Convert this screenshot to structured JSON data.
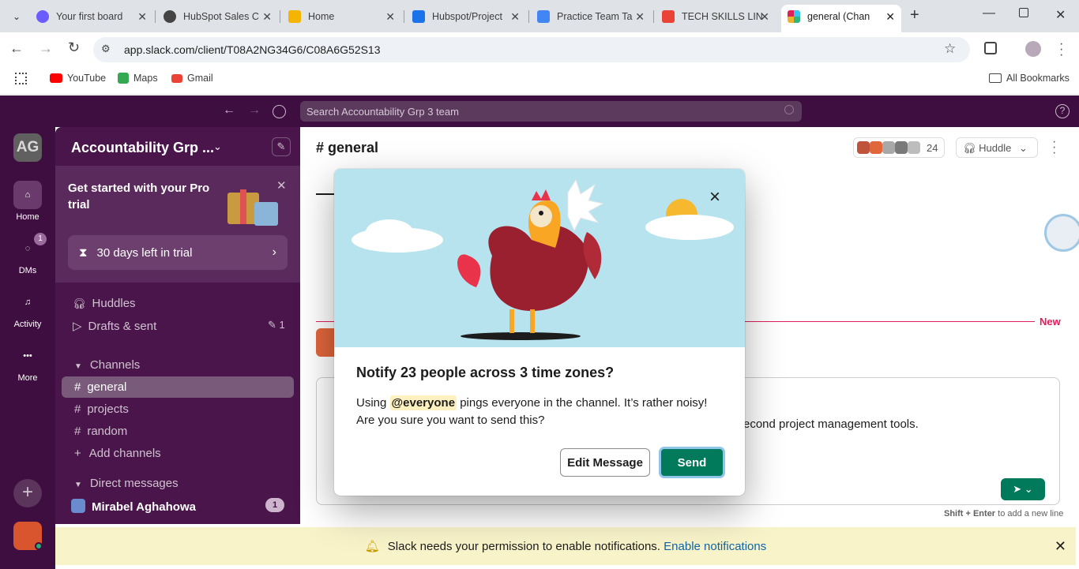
{
  "browser": {
    "tabs": [
      {
        "title": "Your first board",
        "color": "#6a5cff"
      },
      {
        "title": "HubSpot Sales C",
        "color": "#444444"
      },
      {
        "title": "Home",
        "color": "#f4b400"
      },
      {
        "title": "Hubspot/Project",
        "color": "#1a73e8"
      },
      {
        "title": "Practice Team Ta",
        "color": "#4285f4"
      },
      {
        "title": "TECH SKILLS LIN",
        "color": "#ea4335"
      },
      {
        "title": "general (Channe",
        "color": "#e01e5a"
      }
    ],
    "url": "app.slack.com/client/T08A2NG34G6/C08A6G52S13",
    "bookmarks": [
      {
        "label": "YouTube",
        "color": "#ff0000"
      },
      {
        "label": "Maps",
        "color": "#34a853"
      },
      {
        "label": "Gmail",
        "color": "#ea4335"
      }
    ],
    "all_bookmarks": "All Bookmarks"
  },
  "slack": {
    "search_placeholder": "Search Accountability Grp 3 team",
    "workspace_initials": "AG",
    "workspace_name": "Accountability Grp ...",
    "rail": {
      "home": "Home",
      "dms": "DMs",
      "dms_badge": "1",
      "activity": "Activity",
      "more": "More"
    },
    "pro_card": {
      "title": "Get started with your Pro trial",
      "trial_label": "30 days left in trial"
    },
    "nav": {
      "huddles": "Huddles",
      "drafts": "Drafts & sent",
      "drafts_count": "1"
    },
    "channels_header": "Channels",
    "channels": [
      "general",
      "projects",
      "random"
    ],
    "add_channels": "Add channels",
    "dm_header": "Direct messages",
    "dm_user": "Mirabel Aghahowa",
    "dm_badge": "1",
    "channel_title": "# general",
    "member_count": "24",
    "huddle_label": "Huddle",
    "new_label": "New",
    "message_fragment": "econd project management tools.",
    "shift_enter_hint_key": "Shift + Enter",
    "shift_enter_hint_text": " to add a new line",
    "notif_text": "Slack needs your permission to enable notifications.",
    "notif_link": "Enable notifications"
  },
  "modal": {
    "title": "Notify 23 people across 3 time zones?",
    "body_prefix": "Using ",
    "mention": "@everyone",
    "body_suffix": " pings everyone in the channel. It’s rather noisy! Are you sure you want to send this?",
    "edit_label": "Edit Message",
    "send_label": "Send"
  }
}
